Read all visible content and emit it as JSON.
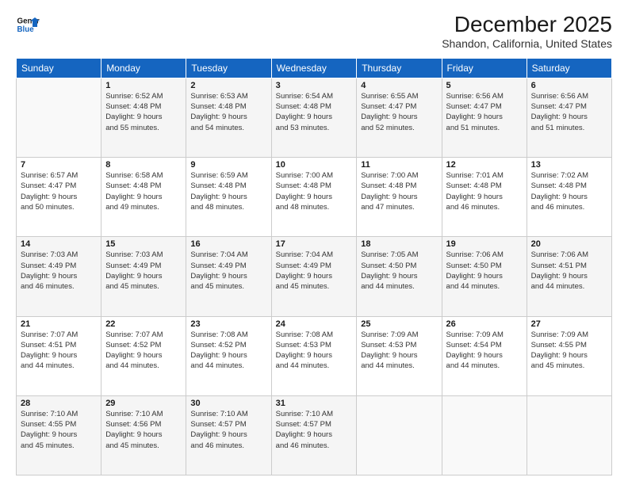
{
  "header": {
    "logo_line1": "General",
    "logo_line2": "Blue",
    "title": "December 2025",
    "subtitle": "Shandon, California, United States"
  },
  "days_of_week": [
    "Sunday",
    "Monday",
    "Tuesday",
    "Wednesday",
    "Thursday",
    "Friday",
    "Saturday"
  ],
  "weeks": [
    [
      {
        "day": "",
        "details": ""
      },
      {
        "day": "1",
        "details": "Sunrise: 6:52 AM\nSunset: 4:48 PM\nDaylight: 9 hours\nand 55 minutes."
      },
      {
        "day": "2",
        "details": "Sunrise: 6:53 AM\nSunset: 4:48 PM\nDaylight: 9 hours\nand 54 minutes."
      },
      {
        "day": "3",
        "details": "Sunrise: 6:54 AM\nSunset: 4:48 PM\nDaylight: 9 hours\nand 53 minutes."
      },
      {
        "day": "4",
        "details": "Sunrise: 6:55 AM\nSunset: 4:47 PM\nDaylight: 9 hours\nand 52 minutes."
      },
      {
        "day": "5",
        "details": "Sunrise: 6:56 AM\nSunset: 4:47 PM\nDaylight: 9 hours\nand 51 minutes."
      },
      {
        "day": "6",
        "details": "Sunrise: 6:56 AM\nSunset: 4:47 PM\nDaylight: 9 hours\nand 51 minutes."
      }
    ],
    [
      {
        "day": "7",
        "details": "Sunrise: 6:57 AM\nSunset: 4:47 PM\nDaylight: 9 hours\nand 50 minutes."
      },
      {
        "day": "8",
        "details": "Sunrise: 6:58 AM\nSunset: 4:48 PM\nDaylight: 9 hours\nand 49 minutes."
      },
      {
        "day": "9",
        "details": "Sunrise: 6:59 AM\nSunset: 4:48 PM\nDaylight: 9 hours\nand 48 minutes."
      },
      {
        "day": "10",
        "details": "Sunrise: 7:00 AM\nSunset: 4:48 PM\nDaylight: 9 hours\nand 48 minutes."
      },
      {
        "day": "11",
        "details": "Sunrise: 7:00 AM\nSunset: 4:48 PM\nDaylight: 9 hours\nand 47 minutes."
      },
      {
        "day": "12",
        "details": "Sunrise: 7:01 AM\nSunset: 4:48 PM\nDaylight: 9 hours\nand 46 minutes."
      },
      {
        "day": "13",
        "details": "Sunrise: 7:02 AM\nSunset: 4:48 PM\nDaylight: 9 hours\nand 46 minutes."
      }
    ],
    [
      {
        "day": "14",
        "details": "Sunrise: 7:03 AM\nSunset: 4:49 PM\nDaylight: 9 hours\nand 46 minutes."
      },
      {
        "day": "15",
        "details": "Sunrise: 7:03 AM\nSunset: 4:49 PM\nDaylight: 9 hours\nand 45 minutes."
      },
      {
        "day": "16",
        "details": "Sunrise: 7:04 AM\nSunset: 4:49 PM\nDaylight: 9 hours\nand 45 minutes."
      },
      {
        "day": "17",
        "details": "Sunrise: 7:04 AM\nSunset: 4:49 PM\nDaylight: 9 hours\nand 45 minutes."
      },
      {
        "day": "18",
        "details": "Sunrise: 7:05 AM\nSunset: 4:50 PM\nDaylight: 9 hours\nand 44 minutes."
      },
      {
        "day": "19",
        "details": "Sunrise: 7:06 AM\nSunset: 4:50 PM\nDaylight: 9 hours\nand 44 minutes."
      },
      {
        "day": "20",
        "details": "Sunrise: 7:06 AM\nSunset: 4:51 PM\nDaylight: 9 hours\nand 44 minutes."
      }
    ],
    [
      {
        "day": "21",
        "details": "Sunrise: 7:07 AM\nSunset: 4:51 PM\nDaylight: 9 hours\nand 44 minutes."
      },
      {
        "day": "22",
        "details": "Sunrise: 7:07 AM\nSunset: 4:52 PM\nDaylight: 9 hours\nand 44 minutes."
      },
      {
        "day": "23",
        "details": "Sunrise: 7:08 AM\nSunset: 4:52 PM\nDaylight: 9 hours\nand 44 minutes."
      },
      {
        "day": "24",
        "details": "Sunrise: 7:08 AM\nSunset: 4:53 PM\nDaylight: 9 hours\nand 44 minutes."
      },
      {
        "day": "25",
        "details": "Sunrise: 7:09 AM\nSunset: 4:53 PM\nDaylight: 9 hours\nand 44 minutes."
      },
      {
        "day": "26",
        "details": "Sunrise: 7:09 AM\nSunset: 4:54 PM\nDaylight: 9 hours\nand 44 minutes."
      },
      {
        "day": "27",
        "details": "Sunrise: 7:09 AM\nSunset: 4:55 PM\nDaylight: 9 hours\nand 45 minutes."
      }
    ],
    [
      {
        "day": "28",
        "details": "Sunrise: 7:10 AM\nSunset: 4:55 PM\nDaylight: 9 hours\nand 45 minutes."
      },
      {
        "day": "29",
        "details": "Sunrise: 7:10 AM\nSunset: 4:56 PM\nDaylight: 9 hours\nand 45 minutes."
      },
      {
        "day": "30",
        "details": "Sunrise: 7:10 AM\nSunset: 4:57 PM\nDaylight: 9 hours\nand 46 minutes."
      },
      {
        "day": "31",
        "details": "Sunrise: 7:10 AM\nSunset: 4:57 PM\nDaylight: 9 hours\nand 46 minutes."
      },
      {
        "day": "",
        "details": ""
      },
      {
        "day": "",
        "details": ""
      },
      {
        "day": "",
        "details": ""
      }
    ]
  ]
}
